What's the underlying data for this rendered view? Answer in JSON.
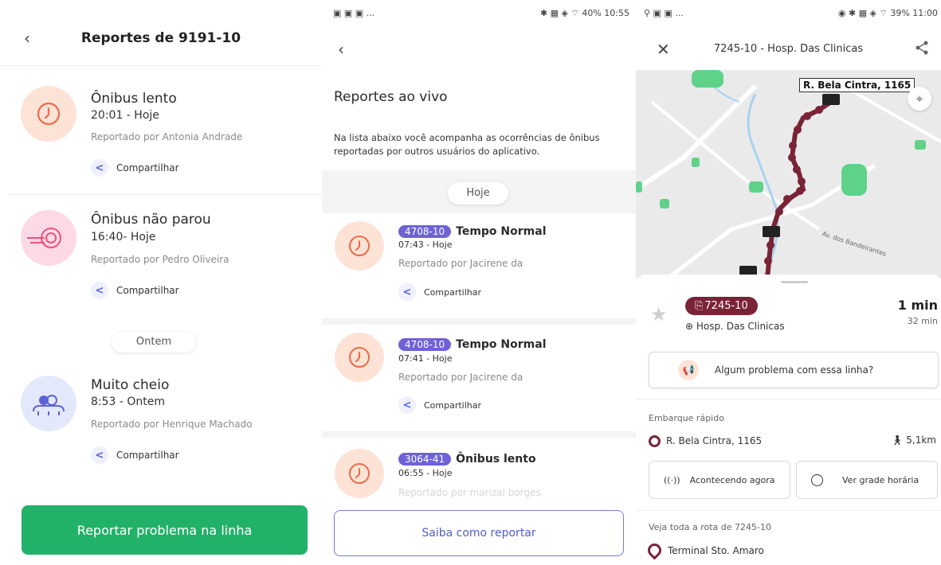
{
  "screen1": {
    "title": "Reportes de 9191-10",
    "reports": [
      {
        "title": "Ônibus lento",
        "time": "20:01 - Hoje",
        "reporter": "Reportado por Antonia Andrade",
        "share": "Compartilhar"
      },
      {
        "title": "Ônibus não parou",
        "time": "16:40- Hoje",
        "reporter": "Reportado por Pedro Oliveira",
        "share": "Compartilhar"
      },
      {
        "title": "Muito cheio",
        "time": "8:53 - Ontem",
        "reporter": "Reportado por Henrique Machado",
        "share": "Compartilhar"
      }
    ],
    "section_label": "Ontem",
    "cta": "Reportar problema na linha"
  },
  "screen2": {
    "status_bar": {
      "left": "...",
      "right": "40% 10:55"
    },
    "title": "Reportes ao vivo",
    "description": "Na lista abaixo você acompanha as ocorrências de ônibus reportadas por outros usuários do aplicativo.",
    "section_label": "Hoje",
    "reports": [
      {
        "line": "4708-10",
        "title": "Tempo Normal",
        "time": "07:43 - Hoje",
        "reporter": "Reportado por Jacirene da",
        "share": "Compartilhar"
      },
      {
        "line": "4708-10",
        "title": "Tempo Normal",
        "time": "07:41 - Hoje",
        "reporter": "Reportado por Jacirene da",
        "share": "Compartilhar"
      },
      {
        "line": "3064-41",
        "title": "Ônibus lento",
        "time": "06:55 - Hoje",
        "reporter": "Reportado por marizal borges",
        "share": ""
      }
    ],
    "cta": "Saiba como reportar"
  },
  "screen3": {
    "status_bar": {
      "left": "...",
      "right": "39% 11:00"
    },
    "header_title": "7245-10 - Hosp. Das Clinicas",
    "map": {
      "stop_label": "R. Bela Cintra, 1165",
      "street_label": "Av. dos Bandeirantes"
    },
    "line_badge": "7245-10",
    "destination": "Hosp. Das Clinicas",
    "eta": "1 min",
    "eta_secondary": "32 min",
    "problem_button": "Algum problema com essa linha?",
    "quick_board_label": "Embarque rápido",
    "stop_name": "R. Bela Cintra, 1165",
    "walk_distance": "5,1km",
    "btn_now": "Acontecendo agora",
    "btn_schedule": "Ver grade horária",
    "route_label": "Veja toda a rota de 7245-10",
    "terminal": "Terminal Sto. Amaro"
  },
  "colors": {
    "green": "#22b169",
    "purple": "#6f62d6",
    "wine": "#7a2336",
    "orange": "#f7b89b",
    "pink": "#f2a0b9",
    "blue": "#5a63d6"
  }
}
